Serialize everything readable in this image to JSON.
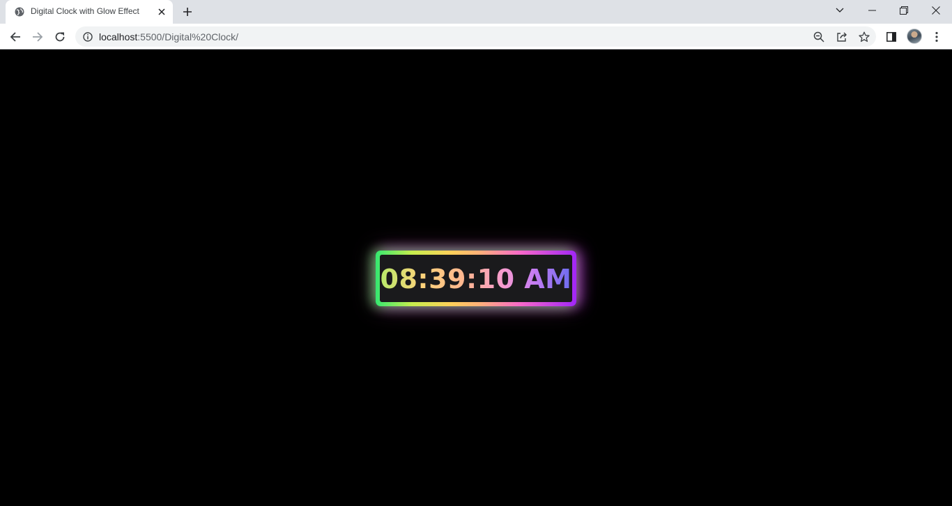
{
  "browser": {
    "tab": {
      "title": "Digital Clock with Glow Effect",
      "favicon": "globe-icon"
    },
    "new_tab_icon": "plus-icon",
    "window_controls": [
      "tab-search-icon",
      "minimize-icon",
      "restore-icon",
      "close-icon"
    ],
    "url": {
      "host": "localhost",
      "path": ":5500/Digital%20Clock/"
    },
    "toolbar_icons": [
      "back-icon",
      "forward-icon",
      "reload-icon",
      "zoom-icon",
      "share-icon",
      "bookmark-star-icon",
      "side-panel-icon",
      "profile-avatar",
      "menu-icon"
    ]
  },
  "clock": {
    "time": "08:39:10 AM"
  },
  "colors": {
    "page_background": "#000000",
    "clock_face": "#1a1a1c",
    "glow_start": "#35e870",
    "glow_mid": "#ffcf5a",
    "glow_pink": "#f769c9",
    "glow_end": "#a126f6"
  }
}
